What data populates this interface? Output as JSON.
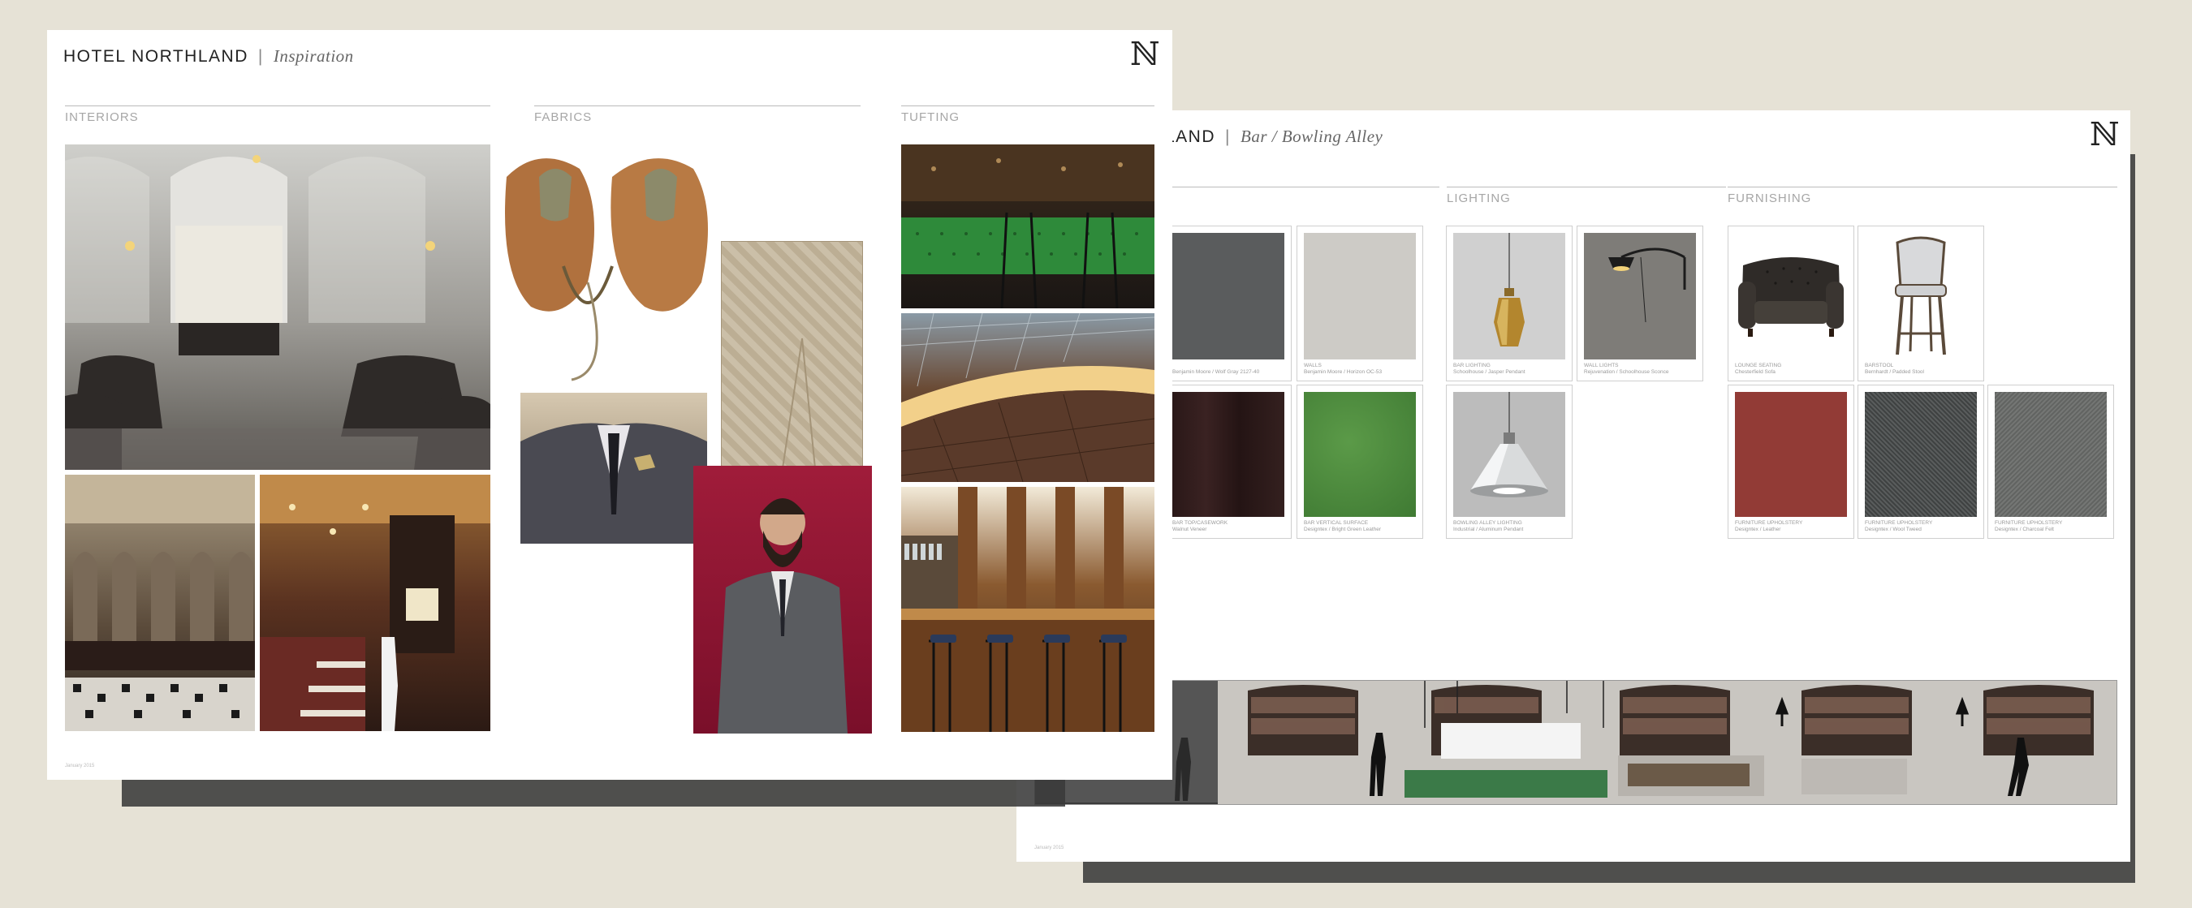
{
  "colors": {
    "background": "#e6e2d6",
    "board": "#ffffff",
    "shadow": "#3a3a3a",
    "rule": "#bbbbbb",
    "label": "#a6a6a6"
  },
  "board_inspiration": {
    "title": "HOTEL NORTHLAND",
    "subtitle": "Inspiration",
    "logo": "ℕ",
    "sections": [
      "INTERIORS",
      "FABRICS",
      "TUFTING"
    ],
    "footer": "January 2015",
    "photos": [
      "interiors-bar-hall-photo",
      "interiors-ornate-bar-photo",
      "interiors-dining-room-photo",
      "fabrics-leather-helmet-photo",
      "fabrics-quilted-pants-photo",
      "fabrics-suit-jacket-photo",
      "fabrics-tweed-man-photo",
      "tufting-green-banquette-photo",
      "tufting-arched-ceiling-photo",
      "tufting-wood-bar-photo"
    ]
  },
  "board_bar": {
    "title_visible": "LAND",
    "subtitle": "Bar / Bowling Alley",
    "logo": "ℕ",
    "sections": [
      "LIGHTING",
      "FURNISHING"
    ],
    "footer": "January 2015",
    "tiles": [
      {
        "caption": "Benjamin Moore / Wolf Gray 2127-40",
        "color": "#5a5c5d"
      },
      {
        "caption": "WALLS\nBenjamin Moore / Horizon OC-53",
        "color": "#cdcbc6"
      },
      {
        "caption": "BAR LIGHTING\nSchoolhouse / Jasper Pendant",
        "icon": "brass-pendant-icon",
        "color": "#d0d0d0"
      },
      {
        "caption": "WALL LIGHTS\nRejuvenation / Schoolhouse Sconce",
        "icon": "wall-sconce-icon",
        "color": "#7e7c78"
      },
      {
        "caption": "LOUNGE SEATING\nChesterfield Sofa",
        "icon": "chesterfield-sofa-icon",
        "color": "#ffffff"
      },
      {
        "caption": "BARSTOOL\nBernhardt / Padded Stool",
        "icon": "barstool-icon",
        "color": "#ffffff"
      },
      {
        "caption": "BAR TOP/CASEWORK\nWalnut Veneer",
        "color": "#2e1a1a"
      },
      {
        "caption": "BAR VERTICAL SURFACE\nDesigntex / Bright Green Leather",
        "color": "#4a8a3c"
      },
      {
        "caption": "BOWLING ALLEY LIGHTING\nIndustrial / Aluminum Pendant",
        "icon": "aluminum-pendant-icon",
        "color": "#bcbcbc"
      },
      {
        "caption": "FURNITURE UPHOLSTERY\nDesigntex / Leather",
        "color": "#923b36"
      },
      {
        "caption": "FURNITURE UPHOLSTERY\nDesigntex / Wool Tweed",
        "color": "#4b4e4e"
      },
      {
        "caption": "FURNITURE UPHOLSTERY\nDesigntex / Charcoal Felt",
        "color": "#6b6d6b"
      }
    ],
    "elevation": "bar-elevation-rendering"
  }
}
